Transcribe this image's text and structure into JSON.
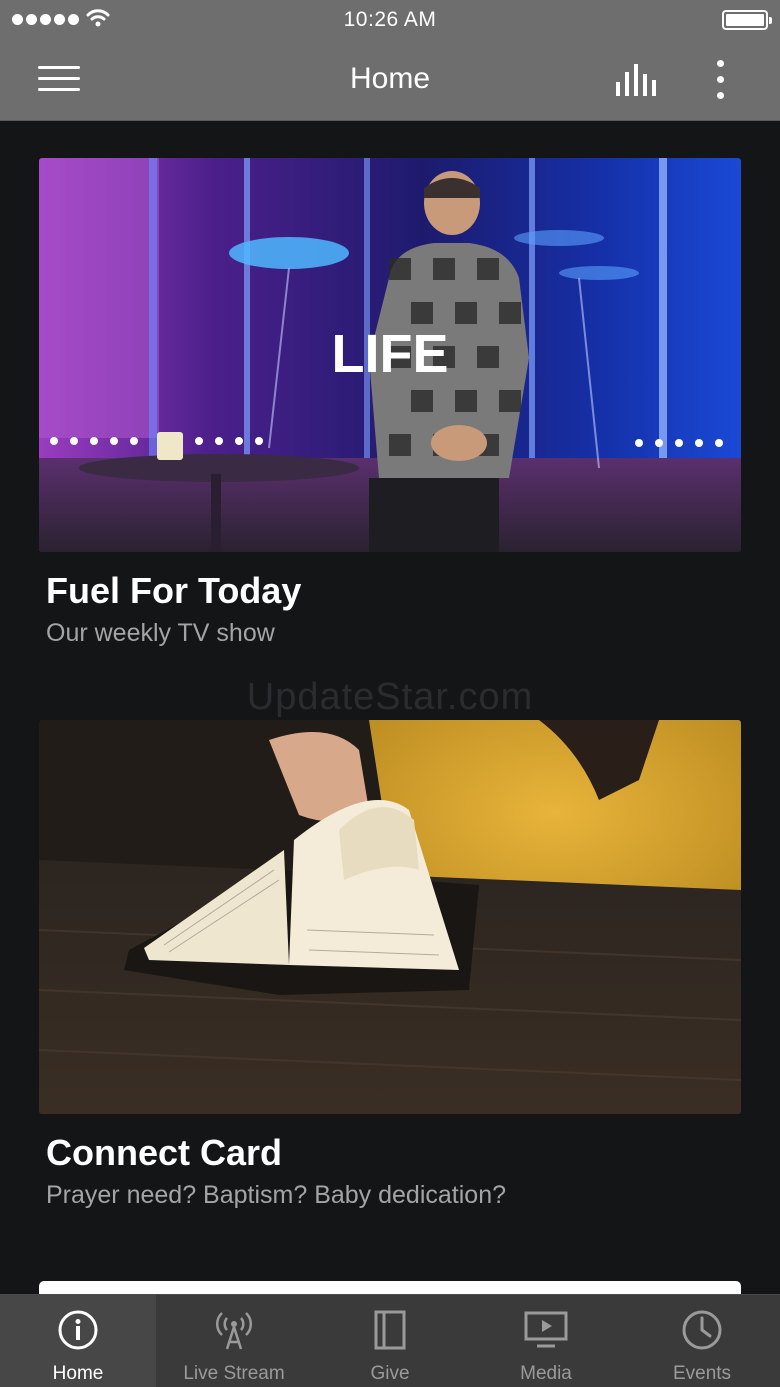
{
  "status_bar": {
    "time": "10:26 AM"
  },
  "nav": {
    "title": "Home"
  },
  "cards": [
    {
      "title": "Fuel For Today",
      "subtitle": "Our weekly TV show",
      "image_text": "LIFE"
    },
    {
      "title": "Connect Card",
      "subtitle": "Prayer need? Baptism? Baby dedication?"
    }
  ],
  "watermark": "UpdateStar.com",
  "tabs": [
    {
      "label": "Home",
      "icon": "info-icon",
      "active": true
    },
    {
      "label": "Live Stream",
      "icon": "broadcast-icon",
      "active": false
    },
    {
      "label": "Give",
      "icon": "book-icon",
      "active": false
    },
    {
      "label": "Media",
      "icon": "play-screen-icon",
      "active": false
    },
    {
      "label": "Events",
      "icon": "clock-icon",
      "active": false
    }
  ],
  "colors": {
    "bar_gray": "#6e6e6e",
    "background": "#141517",
    "tab_bar": "#3a3a3a",
    "subtitle_gray": "#a4a4a4"
  }
}
